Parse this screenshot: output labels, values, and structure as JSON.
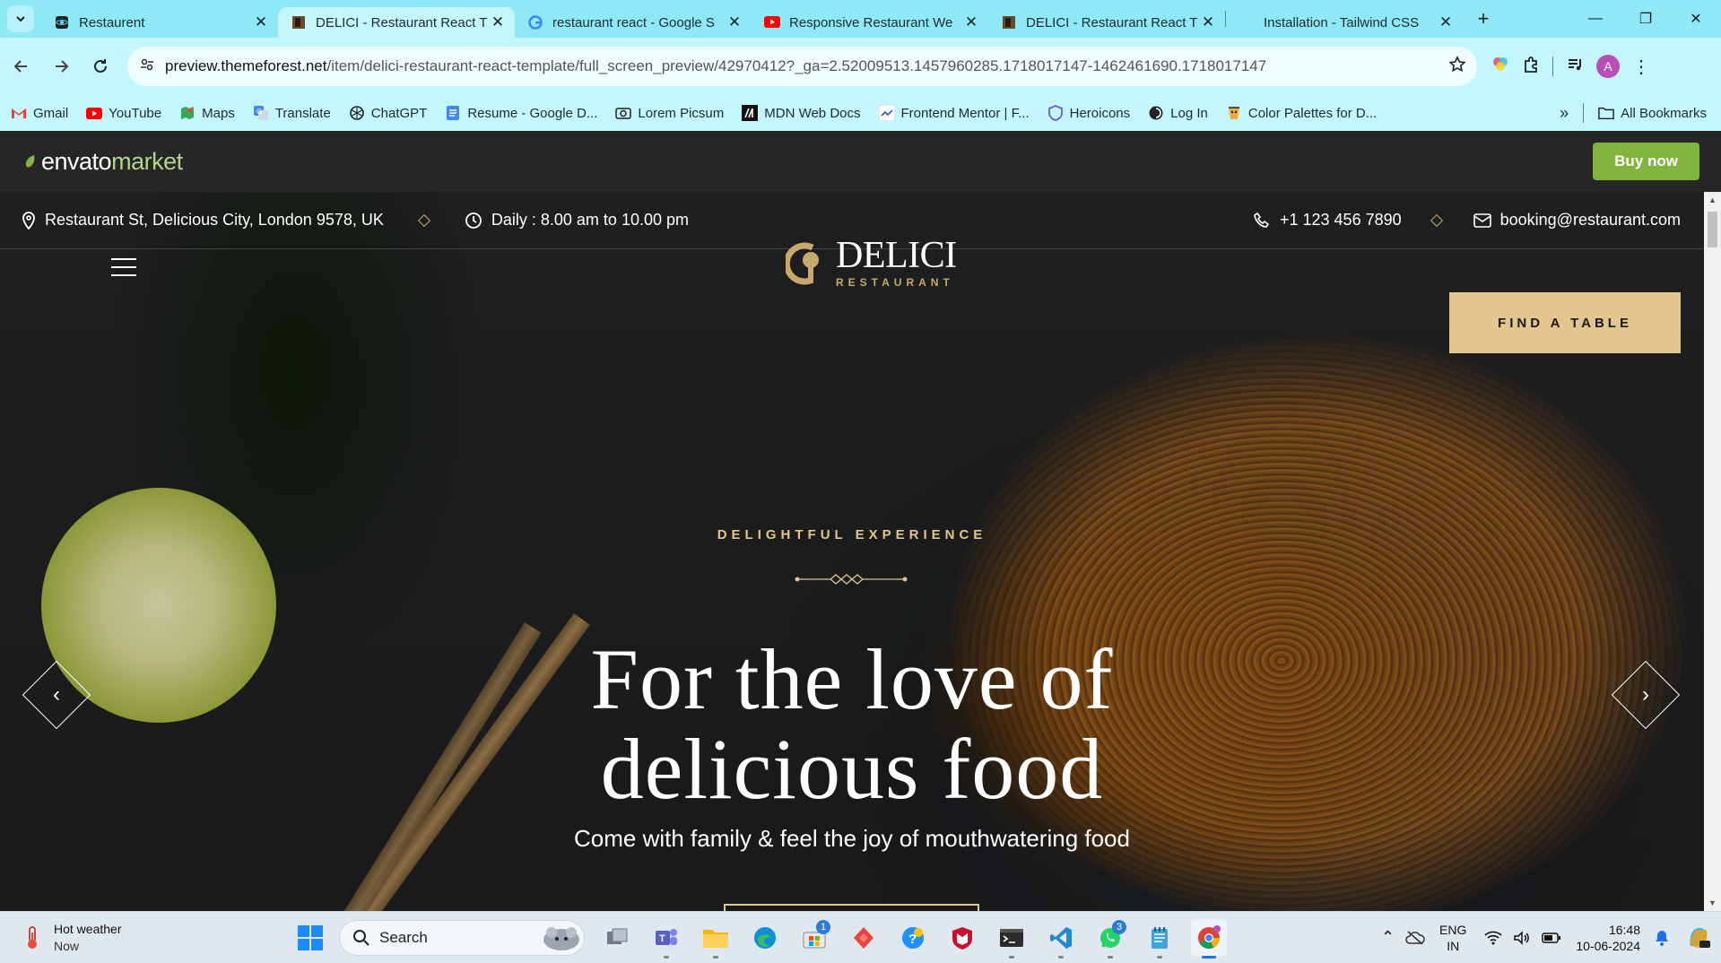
{
  "tabs": [
    {
      "title": "Restaurent",
      "icon": "react-icon",
      "active": false
    },
    {
      "title": "DELICI - Restaurant React T",
      "icon": "delici-icon",
      "active": true
    },
    {
      "title": "restaurant react - Google S",
      "icon": "google-icon",
      "active": false
    },
    {
      "title": "Responsive Restaurant We",
      "icon": "youtube-icon",
      "active": false
    },
    {
      "title": "DELICI - Restaurant React T",
      "icon": "delici-icon",
      "active": false
    },
    {
      "title": "Installation - Tailwind CSS",
      "icon": "tailwind-icon",
      "active": false
    }
  ],
  "address_bar": {
    "host": "preview.themeforest.net",
    "path": "/item/delici-restaurant-react-template/full_screen_preview/42970412?_ga=2.52009513.1457960285.1718017147-1462461690.1718017147"
  },
  "profile_initial": "A",
  "bookmarks": [
    {
      "label": "Gmail",
      "icon": "gmail-icon"
    },
    {
      "label": "YouTube",
      "icon": "youtube-icon"
    },
    {
      "label": "Maps",
      "icon": "maps-icon"
    },
    {
      "label": "Translate",
      "icon": "translate-icon"
    },
    {
      "label": "ChatGPT",
      "icon": "chatgpt-icon"
    },
    {
      "label": "Resume - Google D...",
      "icon": "docs-icon"
    },
    {
      "label": "Lorem Picsum",
      "icon": "picsum-icon"
    },
    {
      "label": "MDN Web Docs",
      "icon": "mdn-icon"
    },
    {
      "label": "Frontend Mentor | F...",
      "icon": "frontend-mentor-icon"
    },
    {
      "label": "Heroicons",
      "icon": "heroicons-icon"
    },
    {
      "label": "Log In",
      "icon": "login-icon"
    },
    {
      "label": "Color Palettes for D...",
      "icon": "palette-icon"
    }
  ],
  "all_bookmarks_label": "All Bookmarks",
  "envato": {
    "logo_word": "envato",
    "logo_market": "market",
    "buy_label": "Buy now",
    "accent": "#82b440"
  },
  "restaurant": {
    "address": "Restaurant St, Delicious City, London 9578, UK",
    "hours": "Daily : 8.00 am to 10.00 pm",
    "phone": "+1 123 456 7890",
    "email": "booking@restaurant.com",
    "logo_name": "DELICI",
    "logo_sub": "RESTAURANT",
    "find_table": "FIND A TABLE",
    "kicker": "DELIGHTFUL EXPERIENCE",
    "headline_line1": "For the love of",
    "headline_line2": "delicious food",
    "subline": "Come with family & feel the joy of mouthwatering food",
    "gold": "#e3c58e"
  },
  "taskbar": {
    "weather_title": "Hot weather",
    "weather_sub": "Now",
    "search_label": "Search",
    "apps": [
      {
        "name": "task-view",
        "badge": null
      },
      {
        "name": "teams",
        "badge": null
      },
      {
        "name": "file-explorer",
        "badge": null
      },
      {
        "name": "edge",
        "badge": null
      },
      {
        "name": "microsoft-store",
        "badge": "1"
      },
      {
        "name": "anydesk",
        "badge": null
      },
      {
        "name": "help",
        "badge": null
      },
      {
        "name": "mcafee",
        "badge": null
      },
      {
        "name": "terminal",
        "badge": null
      },
      {
        "name": "vscode",
        "badge": null
      },
      {
        "name": "whatsapp",
        "badge": "3"
      },
      {
        "name": "notepad",
        "badge": null
      },
      {
        "name": "chrome",
        "badge": null
      }
    ],
    "lang_top": "ENG",
    "lang_bottom": "IN",
    "time": "16:48",
    "date": "10-06-2024"
  }
}
